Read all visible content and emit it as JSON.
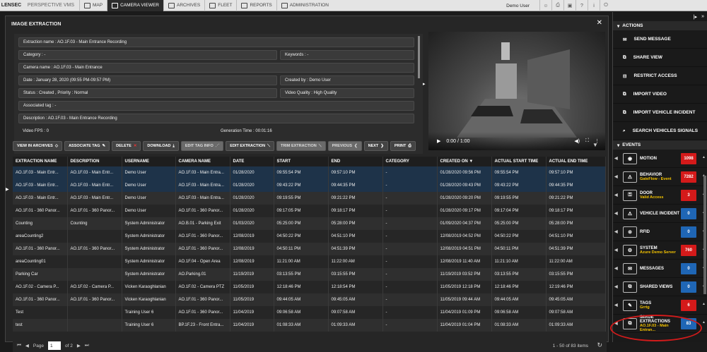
{
  "topbar": {
    "logo": "LENSEC",
    "app": "PERSPECTIVE VMS",
    "tabs": [
      "MAP",
      "CAMERA VIEWER",
      "ARCHIVES",
      "FLEET",
      "REPORTS",
      "ADMINISTRATION"
    ],
    "user": "Demo User"
  },
  "panel": {
    "title": "IMAGE EXTRACTION"
  },
  "meta": {
    "extraction_name": "Extraction name : AO.1F.03 - Main Entrance Recording",
    "category": "Category : -",
    "keywords": "Keywords : -",
    "camera": "Camera name : AO.1F.03 - Main Entrance",
    "date": "Date : January 28, 2020 (09:55 PM-09:57 PM)",
    "created_by": "Created by : Demo User",
    "status": "Status : Created ,  Priority : Normal",
    "quality": "Video Quality : High Quality",
    "tag": "Associated tag : -",
    "description": "Description : AO.1F.03 - Main Entrance Recording",
    "fps": "Video FPS : 0",
    "gen_time": "Generation Time : 00:01:16"
  },
  "video": {
    "time": "0:00 / 1:00"
  },
  "toolbar": [
    "VIEW IN ARCHIVES",
    "ASSOCIATE TAG",
    "DELETE",
    "DOWNLOAD",
    "EDIT TAG INFO",
    "EDIT EXTRACTION",
    "TRIM EXTRACTION",
    "PREVIOUS",
    "NEXT",
    "PRINT"
  ],
  "table": {
    "headers": [
      "EXTRACTION NAME",
      "DESCRIPTION",
      "USERNAME",
      "CAMERA NAME",
      "DATE",
      "START",
      "END",
      "CATEGORY",
      "CREATED ON ▼",
      "ACTUAL START TIME",
      "ACTUAL END TIME"
    ],
    "rows": [
      [
        "AO.1F.03 - Main Entr...",
        "AO.1F.03 - Main Entr...",
        "Demo User",
        "AO.1F.03 - Main Entra...",
        "01/28/2020",
        "09:55:54 PM",
        "09:57:10 PM",
        "-",
        "01/28/2020 09:56 PM",
        "09:55:54 PM",
        "09:57:10 PM"
      ],
      [
        "AO.1F.03 - Main Entr...",
        "AO.1F.03 - Main Entr...",
        "Demo User",
        "AO.1F.03 - Main Entra...",
        "01/28/2020",
        "09:43:22 PM",
        "09:44:35 PM",
        "-",
        "01/28/2020 09:43 PM",
        "09:43:22 PM",
        "09:44:35 PM"
      ],
      [
        "AO.1F.03 - Main Entr...",
        "AO.1F.03 - Main Entr...",
        "Demo User",
        "AO.1F.03 - Main Entra...",
        "01/28/2020",
        "09:19:55 PM",
        "09:21:22 PM",
        "-",
        "01/28/2020 09:20 PM",
        "09:19:55 PM",
        "09:21:22 PM"
      ],
      [
        "AO.1F.01 - 360 Panor...",
        "AO.1F.01 - 360 Panor...",
        "Demo User",
        "AO.1F.01 - 360 Panor...",
        "01/28/2020",
        "09:17:05 PM",
        "09:18:17 PM",
        "-",
        "01/28/2020 09:17 PM",
        "09:17:04 PM",
        "09:18:17 PM"
      ],
      [
        "Counting",
        "Counting",
        "System Administrator",
        "AO.B.01 - Parking Exit",
        "01/03/2020",
        "05:25:00 PM",
        "05:28:00 PM",
        "-",
        "01/09/2020 04:37 PM",
        "05:25:00 PM",
        "05:28:00 PM"
      ],
      [
        "areaCounting2",
        "",
        "System Administrator",
        "AO.1F.01 - 360 Panor...",
        "12/08/2019",
        "04:50:22 PM",
        "04:51:10 PM",
        "-",
        "12/08/2019 04:52 PM",
        "04:50:22 PM",
        "04:51:10 PM"
      ],
      [
        "AO.1F.01 - 360 Panor...",
        "AO.1F.01 - 360 Panor...",
        "System Administrator",
        "AO.1F.01 - 360 Panor...",
        "12/08/2019",
        "04:50:11 PM",
        "04:51:39 PM",
        "-",
        "12/08/2019 04:51 PM",
        "04:50:11 PM",
        "04:51:39 PM"
      ],
      [
        "areaCounting01",
        "",
        "System Administrator",
        "AO.1F.04 - Open Area",
        "12/08/2019",
        "11:21:00 AM",
        "11:22:00 AM",
        "-",
        "12/08/2019 11:40 AM",
        "11:21:10 AM",
        "11:22:00 AM"
      ],
      [
        "Parking Car",
        "",
        "System Administrator",
        "AO.Parking.01",
        "11/19/2019",
        "03:13:55 PM",
        "03:15:55 PM",
        "-",
        "11/19/2019 03:52 PM",
        "03:13:55 PM",
        "03:15:55 PM"
      ],
      [
        "AO.1F.02 - Camera P...",
        "AO.1F.02 - Camera P...",
        "Vicken Karaoghlanian",
        "AO.1F.02 - Camera PTZ",
        "11/05/2019",
        "12:18:46 PM",
        "12:18:54 PM",
        "-",
        "11/05/2019 12:18 PM",
        "12:18:46 PM",
        "12:19:46 PM"
      ],
      [
        "AO.1F.01 - 360 Panor...",
        "AO.1F.01 - 360 Panor...",
        "Vicken Karaoghlanian",
        "AO.1F.01 - 360 Panor...",
        "11/05/2019",
        "09:44:05 AM",
        "09:45:05 AM",
        "-",
        "11/05/2019 09:44 AM",
        "09:44:05 AM",
        "09:45:05 AM"
      ],
      [
        "Test",
        "",
        "Training User 6",
        "AO.1F.01 - 360 Panor...",
        "11/04/2019",
        "09:06:58 AM",
        "09:07:58 AM",
        "-",
        "11/04/2019 01:09 PM",
        "09:06:58 AM",
        "09:07:58 AM"
      ],
      [
        "test",
        "",
        "Training User 6",
        "BP.1F.23 - Front Entra...",
        "11/04/2019",
        "01:08:33 AM",
        "01:09:33 AM",
        "-",
        "11/04/2019 01:04 PM",
        "01:08:33 AM",
        "01:09:33 AM"
      ]
    ]
  },
  "pager": {
    "page_label": "Page",
    "page": "1",
    "of": "of 2",
    "count": "1 - 50 of 83 items"
  },
  "right_panel": {
    "actions_title": "ACTIONS",
    "actions": [
      "SEND MESSAGE",
      "SHARE VIEW",
      "RESTRICT ACCESS",
      "IMPORT VIDEO",
      "IMPORT VEHICLE INCIDENT",
      "SEARCH VEHICLES SIGNALS"
    ],
    "events_title": "EVENTS",
    "events": [
      {
        "name": "MOTION",
        "sub": "",
        "count": "1098",
        "color": "#d41a1a"
      },
      {
        "name": "BEHAVIOR",
        "sub": "GateFlow - Event",
        "count": "7282",
        "color": "#d41a1a"
      },
      {
        "name": "DOOR",
        "sub": "Valid Access",
        "count": "3",
        "color": "#d41a1a"
      },
      {
        "name": "VEHICLE INCIDENT",
        "sub": "",
        "count": "0",
        "color": "#1f66b5"
      },
      {
        "name": "RFID",
        "sub": "",
        "count": "0",
        "color": "#1f66b5"
      },
      {
        "name": "SYSTEM",
        "sub": "Azure Demo Server",
        "count": "760",
        "color": "#d41a1a"
      },
      {
        "name": "MESSAGES",
        "sub": "",
        "count": "0",
        "color": "#1f66b5"
      },
      {
        "name": "SHARED VIEWS",
        "sub": "",
        "count": "0",
        "color": "#1f66b5"
      },
      {
        "name": "TAGS",
        "sub": "Grrtg",
        "count": "6",
        "color": "#d41a1a"
      },
      {
        "name": "IMAGE EXTRACTIONS",
        "sub": "AO.1F.03 - Main Entran...",
        "count": "83",
        "color": "#1f66b5"
      }
    ]
  }
}
